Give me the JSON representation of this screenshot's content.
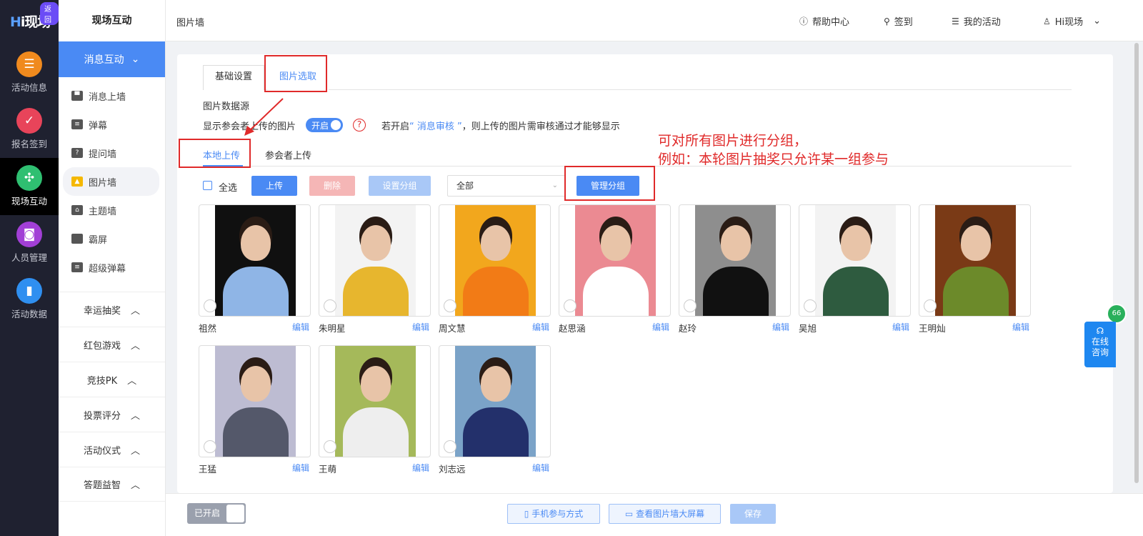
{
  "rail": {
    "logo": "Hi现场",
    "back_badge": "返回",
    "items": [
      {
        "label": "活动信息",
        "icon": "doc-icon",
        "color": "#f08a1e"
      },
      {
        "label": "报名签到",
        "icon": "calendar-check-icon",
        "color": "#e8445a"
      },
      {
        "label": "现场互动",
        "icon": "interact-icon",
        "color": "#2fbf71"
      },
      {
        "label": "人员管理",
        "icon": "person-card-icon",
        "color": "#a23fd6"
      },
      {
        "label": "活动数据",
        "icon": "bar-chart-icon",
        "color": "#2f8ff0"
      }
    ]
  },
  "nav2": {
    "title": "现场互动",
    "group": "消息互动",
    "items": [
      {
        "label": "消息上墙",
        "glyph": "▀"
      },
      {
        "label": "弹幕",
        "glyph": "≡"
      },
      {
        "label": "提问墙",
        "glyph": "?"
      },
      {
        "label": "图片墙",
        "glyph": "▲"
      },
      {
        "label": "主题墙",
        "glyph": "⌂"
      },
      {
        "label": "霸屏",
        "glyph": ""
      },
      {
        "label": "超级弹幕",
        "glyph": "≡"
      }
    ],
    "sections": [
      "幸运抽奖",
      "红包游戏",
      "竞技PK",
      "投票评分",
      "活动仪式",
      "答题益智"
    ]
  },
  "topbar": {
    "crumb": "图片墙",
    "help": "帮助中心",
    "checkin": "签到",
    "my_events": "我的活动",
    "user": "Hi现场"
  },
  "tabs": [
    "基础设置",
    "图片选取"
  ],
  "source_label": "图片数据源",
  "option": {
    "label": "显示参会者上传的图片",
    "toggle": "开启",
    "note_prefix": "若开启",
    "note_highlight": "“ 消息审核 ”",
    "note_suffix": "，则上传的图片需审核通过才能够显示"
  },
  "subtabs": [
    "本地上传",
    "参会者上传"
  ],
  "toolbar": {
    "select_all": "全选",
    "upload": "上传",
    "delete": "删除",
    "set_group": "设置分组",
    "group_select": "全部",
    "manage_group": "管理分组"
  },
  "photos": [
    {
      "name": "祖然",
      "bg": "#101010",
      "shirt": "#8fb5e6"
    },
    {
      "name": "朱明星",
      "bg": "#f3f3f3",
      "shirt": "#e7b62e"
    },
    {
      "name": "周文慧",
      "bg": "#f2a71d",
      "shirt": "#f27b16"
    },
    {
      "name": "赵思涵",
      "bg": "#eb8a92",
      "shirt": "#ffffff"
    },
    {
      "name": "赵玲",
      "bg": "#8e8e8e",
      "shirt": "#111111"
    },
    {
      "name": "吴旭",
      "bg": "#f3f3f3",
      "shirt": "#2e5b3f"
    },
    {
      "name": "王明灿",
      "bg": "#7a3a16",
      "shirt": "#6c8a2a"
    },
    {
      "name": "王猛",
      "bg": "#bdbcd2",
      "shirt": "#54586a"
    },
    {
      "name": "王萌",
      "bg": "#a5b95a",
      "shirt": "#eeeeee"
    },
    {
      "name": "刘志远",
      "bg": "#7ba3c8",
      "shirt": "#23306b"
    }
  ],
  "edit_label": "编辑",
  "annotation": {
    "line1": "可对所有图片进行分组，",
    "line2": "例如：本轮图片抽奖只允许某一组参与"
  },
  "bottom": {
    "enabled": "已开启",
    "mobile": "手机参与方式",
    "bigscreen": "查看图片墙大屏幕",
    "save": "保存"
  },
  "consult": {
    "line1": "在线",
    "line2": "咨询",
    "badge": "66"
  },
  "colors": {
    "accent": "#4a8af4",
    "annotation": "#e02a2a",
    "rail": "#1f2130"
  }
}
